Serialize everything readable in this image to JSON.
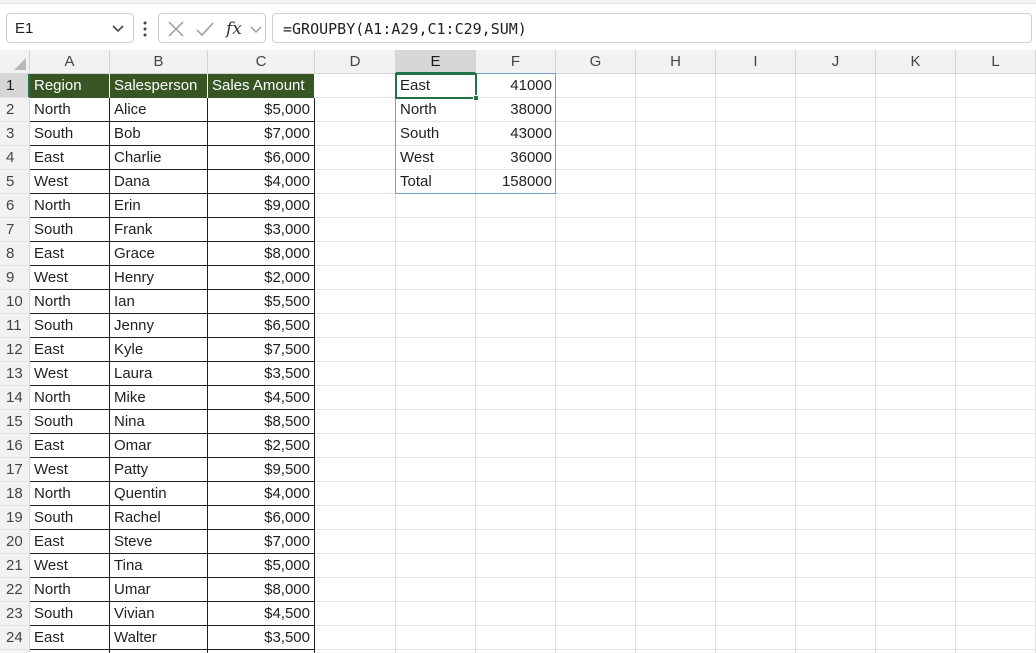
{
  "namebox": {
    "value": "E1"
  },
  "formula_bar": {
    "formula": "=GROUPBY(A1:A29,C1:C29,SUM)"
  },
  "icons": {
    "namebox_dropdown": "chevron-down-icon",
    "more": "more-vertical-icon",
    "cancel": "close-icon",
    "enter": "check-icon",
    "function": "fx-icon",
    "function_dropdown": "chevron-down-icon"
  },
  "columns": [
    "A",
    "B",
    "C",
    "D",
    "E",
    "F",
    "G",
    "H",
    "I",
    "J",
    "K",
    "L"
  ],
  "active": {
    "column": "E",
    "row": "1"
  },
  "colors": {
    "header_fill": "#375623",
    "header_text": "#ffffff",
    "selection": "#217346",
    "spill_border": "#6fa0d8"
  },
  "table": {
    "headers": [
      "Region",
      "Salesperson",
      "Sales Amount"
    ],
    "rows": [
      [
        "North",
        "Alice",
        "$5,000"
      ],
      [
        "South",
        "Bob",
        "$7,000"
      ],
      [
        "East",
        "Charlie",
        "$6,000"
      ],
      [
        "West",
        "Dana",
        "$4,000"
      ],
      [
        "North",
        "Erin",
        "$9,000"
      ],
      [
        "South",
        "Frank",
        "$3,000"
      ],
      [
        "East",
        "Grace",
        "$8,000"
      ],
      [
        "West",
        "Henry",
        "$2,000"
      ],
      [
        "North",
        "Ian",
        "$5,500"
      ],
      [
        "South",
        "Jenny",
        "$6,500"
      ],
      [
        "East",
        "Kyle",
        "$7,500"
      ],
      [
        "West",
        "Laura",
        "$3,500"
      ],
      [
        "North",
        "Mike",
        "$4,500"
      ],
      [
        "South",
        "Nina",
        "$8,500"
      ],
      [
        "East",
        "Omar",
        "$2,500"
      ],
      [
        "West",
        "Patty",
        "$9,500"
      ],
      [
        "North",
        "Quentin",
        "$4,000"
      ],
      [
        "South",
        "Rachel",
        "$6,000"
      ],
      [
        "East",
        "Steve",
        "$7,000"
      ],
      [
        "West",
        "Tina",
        "$5,000"
      ],
      [
        "North",
        "Umar",
        "$8,000"
      ],
      [
        "South",
        "Vivian",
        "$4,500"
      ],
      [
        "East",
        "Walter",
        "$3,500"
      ]
    ]
  },
  "groupby_result": [
    [
      "East",
      "41000"
    ],
    [
      "North",
      "38000"
    ],
    [
      "South",
      "43000"
    ],
    [
      "West",
      "36000"
    ],
    [
      "Total",
      "158000"
    ]
  ]
}
